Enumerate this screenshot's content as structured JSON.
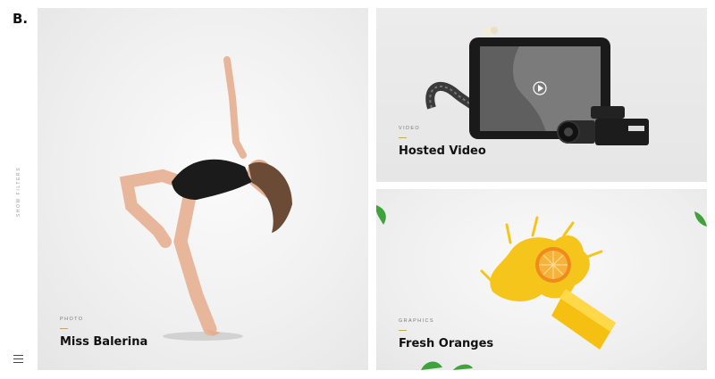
{
  "brand": {
    "logo": "B."
  },
  "sidebar": {
    "filters_label": "SHOW FILTERS",
    "menu_icon": "hamburger-icon"
  },
  "portfolio": {
    "items": [
      {
        "category": "PHOTO",
        "title": "Miss Balerina"
      },
      {
        "category": "VIDEO",
        "title": "Hosted Video"
      },
      {
        "category": "GRAPHICS",
        "title": "Fresh Oranges"
      }
    ]
  },
  "colors": {
    "accent": "#c9a46a",
    "text": "#111111",
    "muted": "#7a7a7a"
  }
}
